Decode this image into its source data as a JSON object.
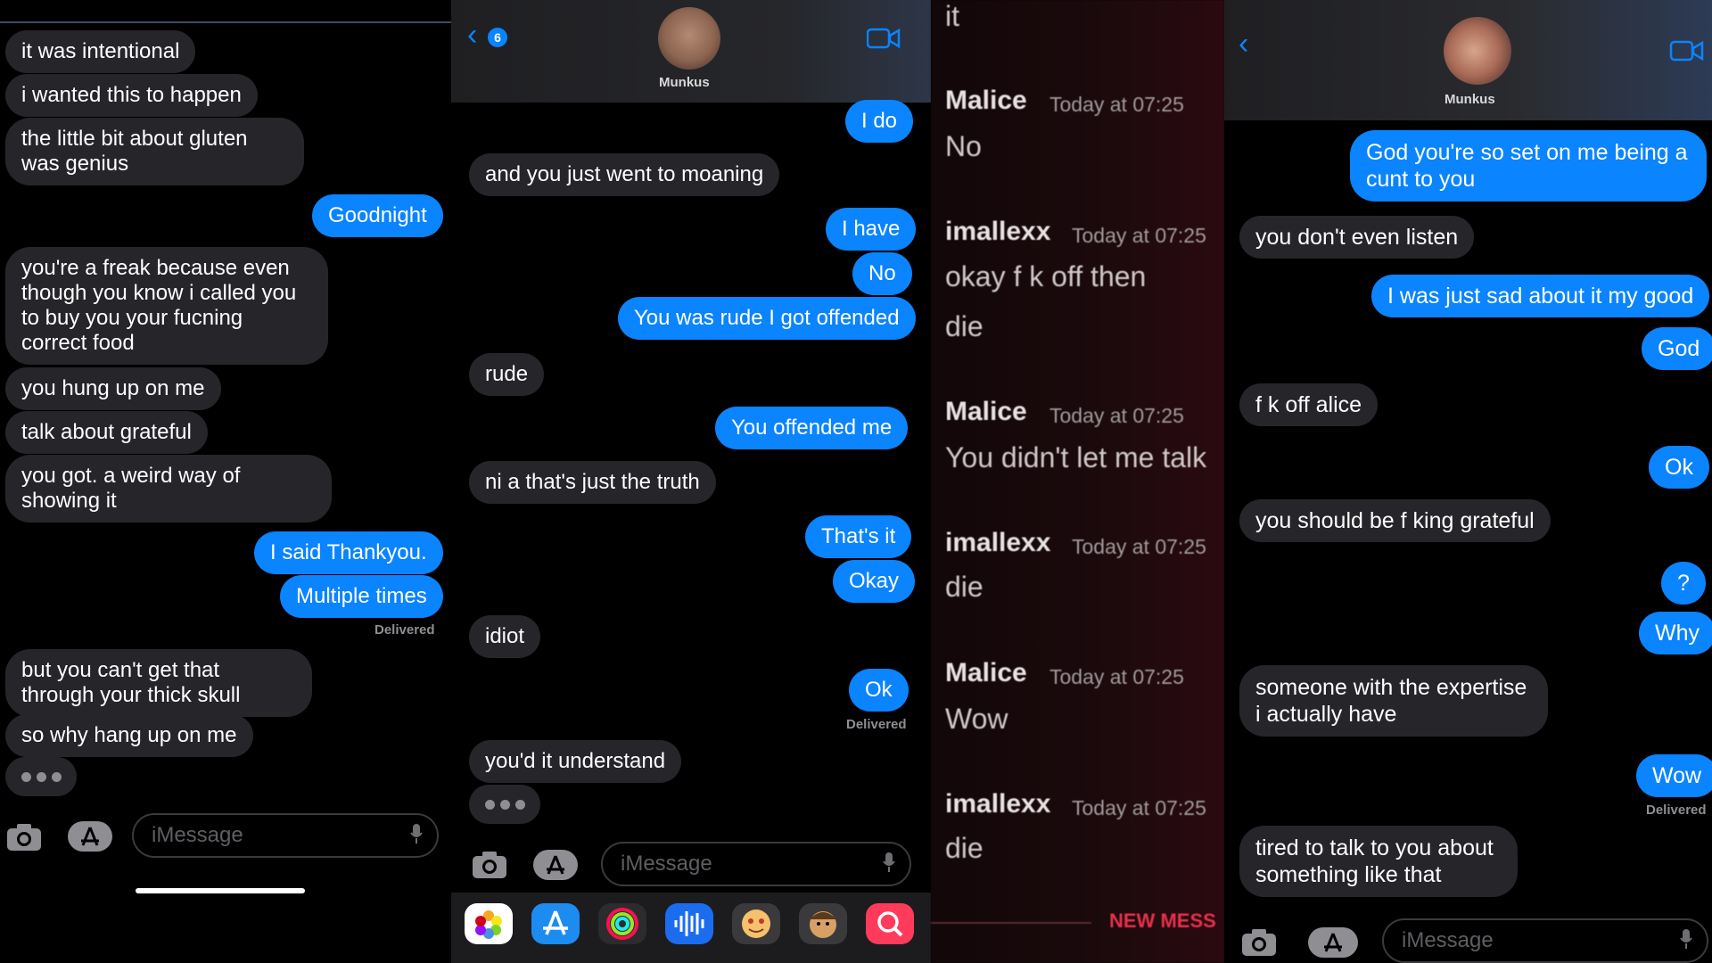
{
  "panel1": {
    "messages": [
      {
        "dir": "recv",
        "text": "it was intentional"
      },
      {
        "dir": "recv",
        "text": "i wanted this to happen"
      },
      {
        "dir": "recv",
        "text": "the little bit about gluten was genius"
      },
      {
        "dir": "sent",
        "text": "Goodnight"
      },
      {
        "dir": "recv",
        "text": "you're a freak because even though you know i called you to buy you your fucning correct food"
      },
      {
        "dir": "recv",
        "text": "you hung up on me"
      },
      {
        "dir": "recv",
        "text": "talk about grateful"
      },
      {
        "dir": "recv",
        "text": "you got. a weird way of showing it"
      },
      {
        "dir": "sent",
        "text": "I said Thankyou."
      },
      {
        "dir": "sent",
        "text": "Multiple times"
      },
      {
        "dir": "recv",
        "text": "but you can't get that through your thick skull"
      },
      {
        "dir": "recv",
        "text": "so why hang up on me"
      }
    ],
    "delivered": "Delivered",
    "input_placeholder": "iMessage"
  },
  "panel2": {
    "contact_name": "Munkus",
    "back_badge": "6",
    "messages": [
      {
        "dir": "sent",
        "text": "I do"
      },
      {
        "dir": "recv",
        "text": "and you just went to moaning"
      },
      {
        "dir": "sent",
        "text": "I have"
      },
      {
        "dir": "sent",
        "text": "No"
      },
      {
        "dir": "sent",
        "text": "You was rude I got offended"
      },
      {
        "dir": "recv",
        "text": "rude"
      },
      {
        "dir": "sent",
        "text": "You offended me"
      },
      {
        "dir": "recv",
        "text": "ni      a that's just the truth"
      },
      {
        "dir": "sent",
        "text": "That's it"
      },
      {
        "dir": "sent",
        "text": "Okay"
      },
      {
        "dir": "recv",
        "text": "idiot"
      },
      {
        "dir": "sent",
        "text": "Ok"
      },
      {
        "dir": "recv",
        "text": "you'd it understand"
      }
    ],
    "delivered": "Delivered",
    "input_placeholder": "iMessage",
    "apps": [
      {
        "name": "photos-app-icon",
        "color": "#ffffff"
      },
      {
        "name": "app-store-icon",
        "color": "#1c8cf0"
      },
      {
        "name": "activity-icon",
        "color": "#2c2c2e"
      },
      {
        "name": "audio-message-icon",
        "color": "#1c6cf0"
      },
      {
        "name": "memoji-icon",
        "color": "#3a3a3c"
      },
      {
        "name": "memoji-stickers-icon",
        "color": "#3a3a3c"
      },
      {
        "name": "search-images-icon",
        "color": "#ff3b5c"
      }
    ]
  },
  "panel3": {
    "top_text": "it",
    "entries": [
      {
        "name": "Malice",
        "time": "Today at 07:25",
        "lines": [
          "No"
        ]
      },
      {
        "name": "imallexx",
        "time": "Today at 07:25",
        "lines": [
          "okay f    k off then",
          "die"
        ]
      },
      {
        "name": "Malice",
        "time": "Today at 07:25",
        "lines": [
          "You didn't let me talk"
        ]
      },
      {
        "name": "imallexx",
        "time": "Today at 07:25",
        "lines": [
          "die"
        ]
      },
      {
        "name": "Malice",
        "time": "Today at 07:25",
        "lines": [
          "Wow"
        ]
      },
      {
        "name": "imallexx",
        "time": "Today at 07:25",
        "lines": [
          "die"
        ]
      }
    ],
    "new_messages": "NEW MESS"
  },
  "panel4": {
    "contact_name": "Munkus",
    "messages": [
      {
        "dir": "sent",
        "text": "God you're so set on me being a cunt to you"
      },
      {
        "dir": "recv",
        "text": "you don't even listen"
      },
      {
        "dir": "sent",
        "text": "I was just sad about it my good"
      },
      {
        "dir": "sent",
        "text": "God"
      },
      {
        "dir": "recv",
        "text": "f    k off alice"
      },
      {
        "dir": "sent",
        "text": "Ok"
      },
      {
        "dir": "recv",
        "text": "you should be f     king grateful"
      },
      {
        "dir": "sent",
        "text": "?"
      },
      {
        "dir": "sent",
        "text": "Why"
      },
      {
        "dir": "recv",
        "text": "someone with the expertise i actually have"
      },
      {
        "dir": "sent",
        "text": "Wow"
      },
      {
        "dir": "recv",
        "text": "tired to talk to you about something like that"
      }
    ],
    "delivered": "Delivered",
    "input_placeholder": "iMessage"
  },
  "colors": {
    "sent": "#0a84ff",
    "recv": "#26252a",
    "accent": "#0a84ff",
    "new_messages": "#e8304a"
  }
}
